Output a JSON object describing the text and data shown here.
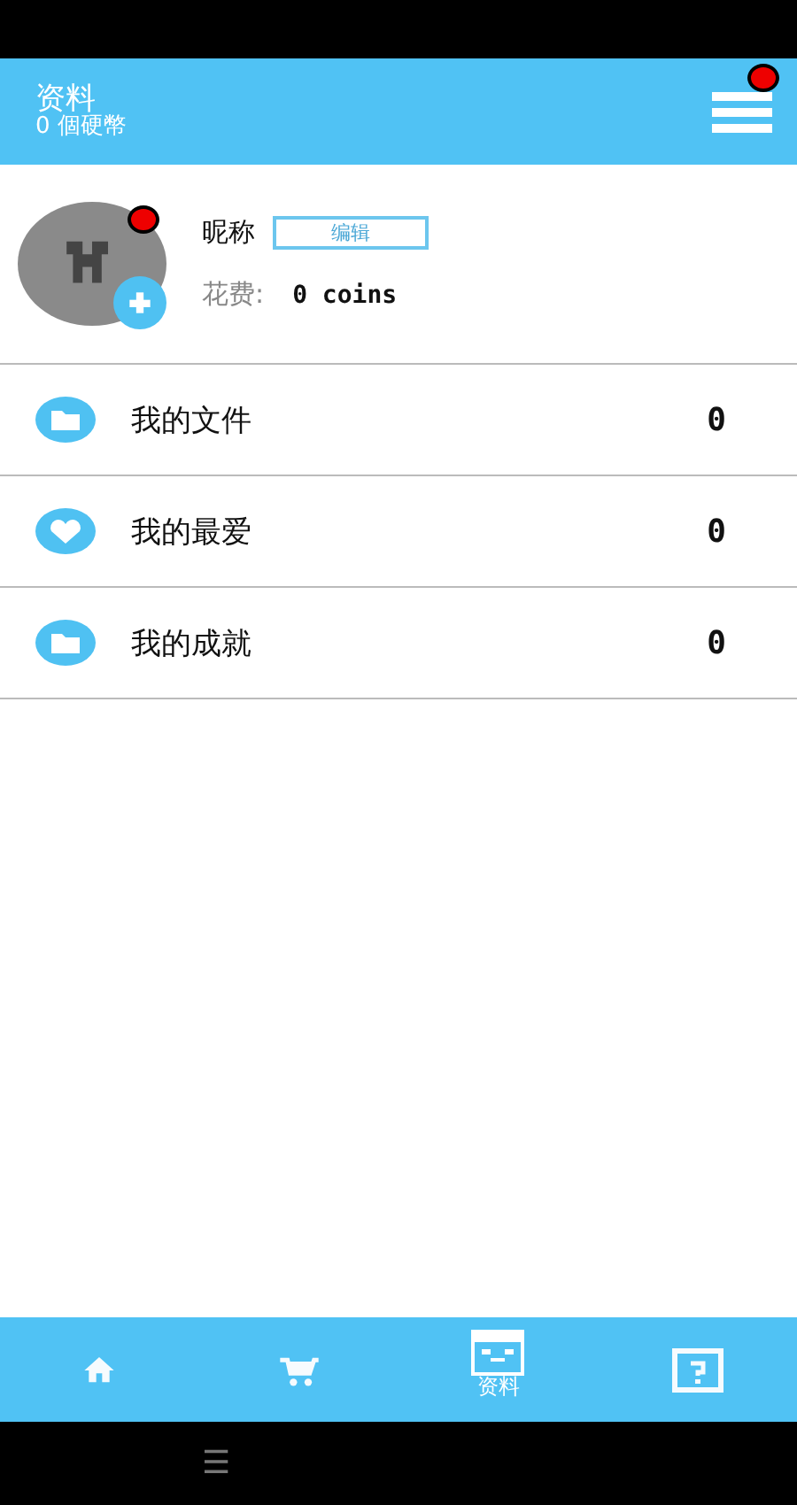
{
  "header": {
    "title": "资料",
    "coins": "0 個硬幣",
    "menu_alert": true
  },
  "profile": {
    "avatar_alert": true,
    "nickname": "昵称",
    "edit_button": "编辑",
    "cost_label": "花费:",
    "cost_value": "0 coins"
  },
  "items": [
    {
      "kind": "folder",
      "label": "我的文件",
      "count": "0"
    },
    {
      "kind": "heart",
      "label": "我的最爱",
      "count": "0"
    },
    {
      "kind": "folder",
      "label": "我的成就",
      "count": "0"
    }
  ],
  "tabs": [
    {
      "kind": "home",
      "selected": false
    },
    {
      "kind": "cart",
      "selected": false
    },
    {
      "kind": "profile",
      "label": "资料",
      "selected": true
    },
    {
      "kind": "help",
      "selected": false
    }
  ],
  "system_bar": {
    "menu_glyph": "☰"
  }
}
